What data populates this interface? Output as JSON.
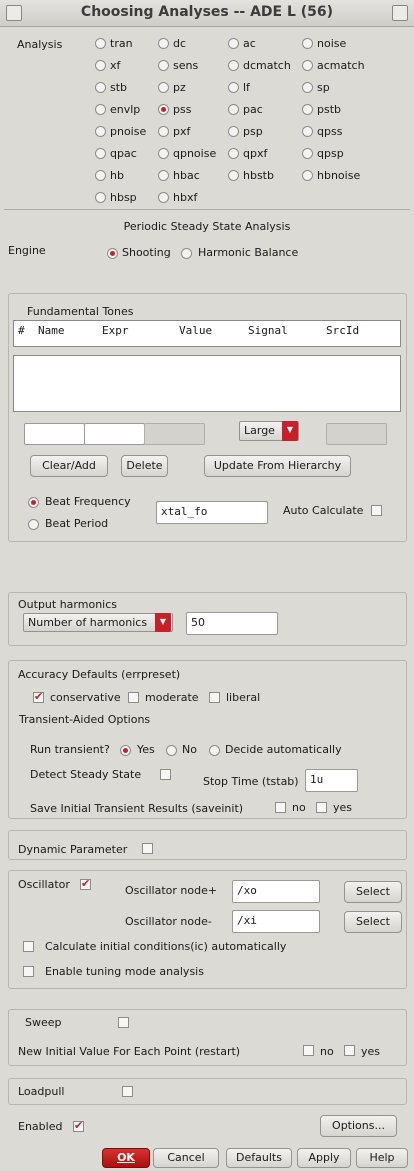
{
  "window": {
    "title": "Choosing Analyses -- ADE L (56)"
  },
  "analysis": {
    "label": "Analysis",
    "options": [
      "tran",
      "dc",
      "ac",
      "noise",
      "xf",
      "sens",
      "dcmatch",
      "acmatch",
      "stb",
      "pz",
      "lf",
      "sp",
      "envlp",
      "pss",
      "pac",
      "pstb",
      "pnoise",
      "pxf",
      "psp",
      "qpss",
      "qpac",
      "qpnoise",
      "qpxf",
      "qpsp",
      "hb",
      "hbac",
      "hbstb",
      "hbnoise",
      "hbsp",
      "hbxf"
    ],
    "selected": "pss"
  },
  "pss": {
    "heading": "Periodic Steady State Analysis",
    "engine_label": "Engine",
    "engine_options": [
      "Shooting",
      "Harmonic Balance"
    ],
    "engine_selected": "Shooting"
  },
  "tones": {
    "title": "Fundamental Tones",
    "columns": [
      "#",
      "Name",
      "Expr",
      "Value",
      "Signal",
      "SrcId"
    ],
    "signal_select": "Large",
    "clear_add": "Clear/Add",
    "delete": "Delete",
    "update": "Update From Hierarchy",
    "beat_frequency": "Beat Frequency",
    "beat_period": "Beat Period",
    "beat_selected": "Beat Frequency",
    "beat_value": "xtal_fo",
    "auto_calculate": "Auto Calculate",
    "auto_calculate_checked": false
  },
  "harmonics": {
    "title": "Output harmonics",
    "mode": "Number of harmonics",
    "value": "50"
  },
  "accuracy": {
    "title": "Accuracy Defaults (errpreset)",
    "options": [
      "conservative",
      "moderate",
      "liberal"
    ],
    "checked": "conservative",
    "transient_title": "Transient-Aided Options",
    "run_transient_label": "Run transient?",
    "run_options": [
      "Yes",
      "No",
      "Decide automatically"
    ],
    "run_selected": "Yes",
    "detect_label": "Detect Steady State",
    "detect_checked": false,
    "stop_time_label": "Stop Time (tstab)",
    "stop_time_value": "1u",
    "save_label": "Save Initial Transient Results (saveinit)",
    "save_no": "no",
    "save_yes": "yes"
  },
  "dynamic": {
    "label": "Dynamic Parameter",
    "checked": false
  },
  "oscillator": {
    "label": "Oscillator",
    "checked": true,
    "node_plus_label": "Oscillator node+",
    "node_plus_value": "/xo",
    "node_minus_label": "Oscillator node-",
    "node_minus_value": "/xi",
    "select": "Select",
    "calc_ic": "Calculate initial conditions(ic) automatically",
    "tuning": "Enable tuning mode analysis"
  },
  "sweep": {
    "label": "Sweep",
    "restart_label": "New Initial Value For Each Point (restart)",
    "no": "no",
    "yes": "yes"
  },
  "loadpull": {
    "label": "Loadpull"
  },
  "footer": {
    "enabled_label": "Enabled",
    "enabled_checked": true,
    "options": "Options...",
    "ok": "OK",
    "cancel": "Cancel",
    "defaults": "Defaults",
    "apply": "Apply",
    "help": "Help"
  },
  "colors": {
    "accent": "#c8202a",
    "background": "#dcdad5"
  }
}
